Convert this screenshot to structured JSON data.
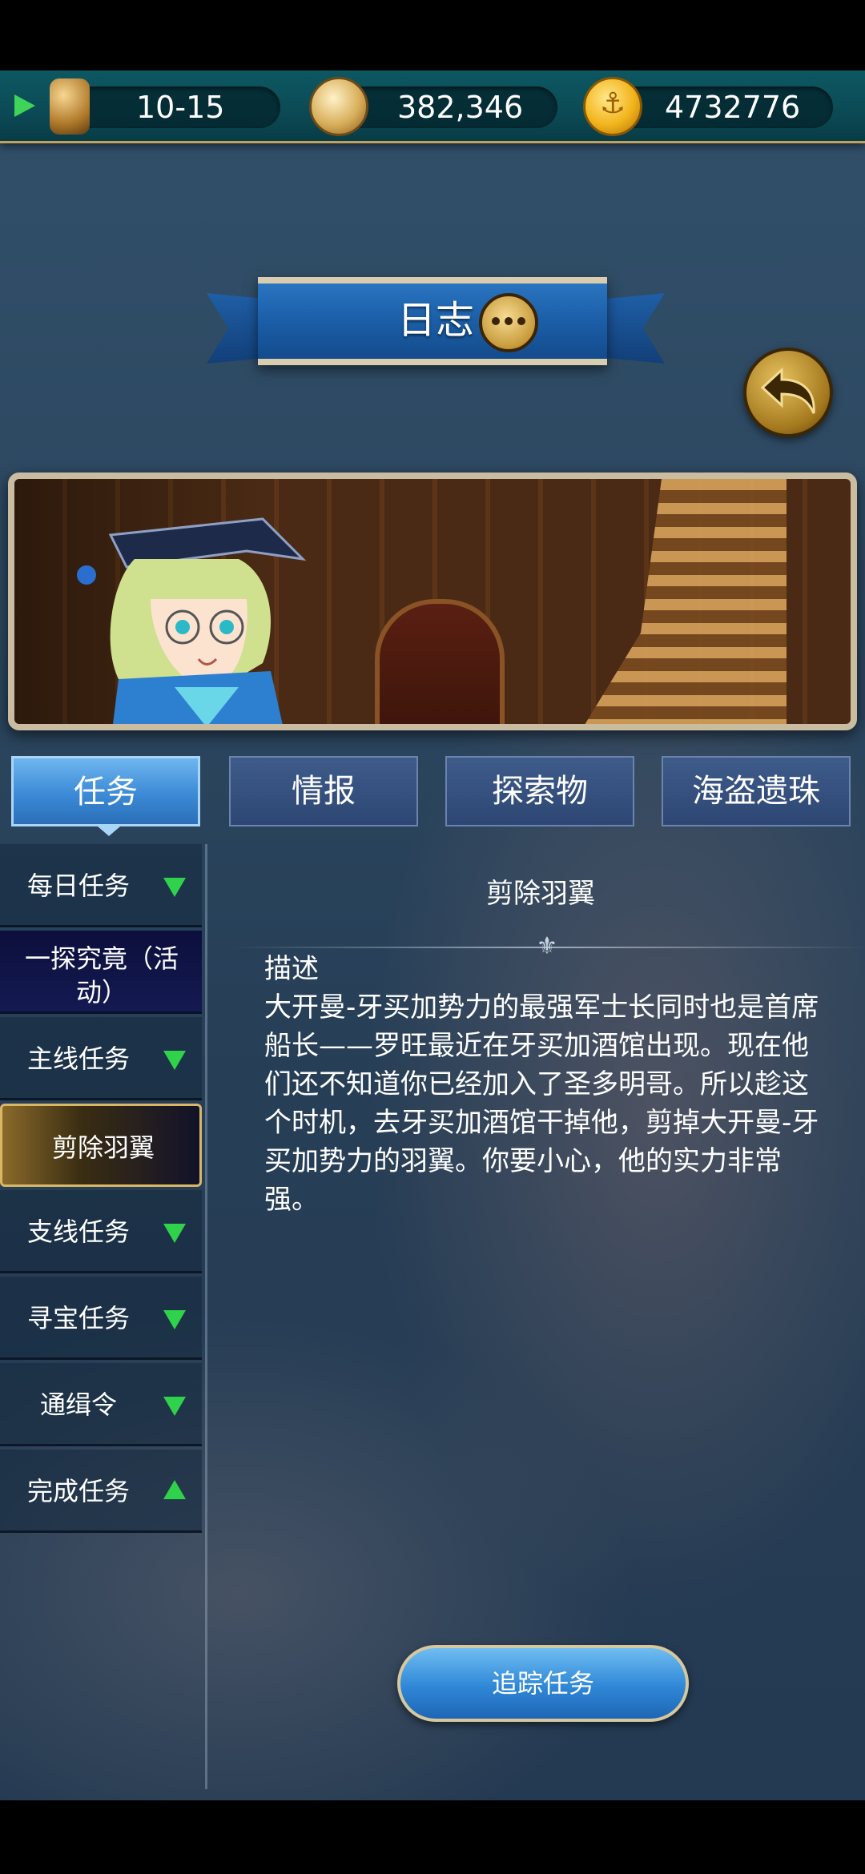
{
  "status_bar": {
    "time_range": "10-15",
    "compass_value": "382,346",
    "gold_value": "4732776",
    "icons": [
      "play-icon",
      "hourglass-icon",
      "compass-icon",
      "anchor-coin-icon"
    ]
  },
  "header": {
    "title": "日志",
    "icons": [
      "chat-bubble-icon",
      "back-arrow-icon"
    ]
  },
  "tabs": [
    {
      "label": "任务",
      "active": true
    },
    {
      "label": "情报",
      "active": false
    },
    {
      "label": "探索物",
      "active": false
    },
    {
      "label": "海盗遗珠",
      "active": false
    }
  ],
  "sidebar": {
    "items": [
      {
        "label": "每日任务",
        "state": "collapsed"
      },
      {
        "label": "一探究竟（活动）",
        "state": "event"
      },
      {
        "label": "主线任务",
        "state": "collapsed"
      },
      {
        "label": "剪除羽翼",
        "state": "selected"
      },
      {
        "label": "支线任务",
        "state": "collapsed"
      },
      {
        "label": "寻宝任务",
        "state": "collapsed"
      },
      {
        "label": "通缉令",
        "state": "collapsed"
      },
      {
        "label": "完成任务",
        "state": "expanded"
      }
    ]
  },
  "quest": {
    "title": "剪除羽翼",
    "desc_heading": "描述",
    "desc_body": "大开曼-牙买加势力的最强军士长同时也是首席船长——罗旺最近在牙买加酒馆出现。现在他们还不知道你已经加入了圣多明哥。所以趁这个时机，去牙买加酒馆干掉他，剪掉大开曼-牙买加势力的羽翼。你要小心，他的实力非常强。"
  },
  "actions": {
    "track_label": "追踪任务"
  },
  "colors": {
    "accent_blue": "#2f87d6",
    "gold": "#d9b765",
    "triangle_green": "#2fd24a",
    "status_teal": "#0b4a55"
  }
}
